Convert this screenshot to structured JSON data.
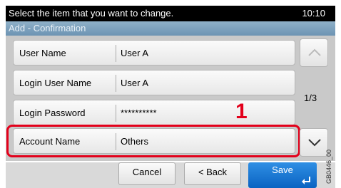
{
  "header": {
    "message": "Select the item that you want to change.",
    "time": "10:10",
    "subtitle": "Add - Confirmation"
  },
  "rows": [
    {
      "label": "User Name",
      "value": "User A"
    },
    {
      "label": "Login User Name",
      "value": "User A"
    },
    {
      "label": "Login Password",
      "value": "**********"
    },
    {
      "label": "Account Name",
      "value": "Others"
    }
  ],
  "callout_number": "1",
  "pagination": {
    "current": "1/3"
  },
  "buttons": {
    "cancel": "Cancel",
    "back": "< Back",
    "save": "Save"
  },
  "doc_code": "GB0446_00",
  "colors": {
    "highlight": "#e3001b",
    "save": "#0a63c2"
  },
  "icons": [
    "up-arrow-icon",
    "down-arrow-icon",
    "enter-icon"
  ]
}
